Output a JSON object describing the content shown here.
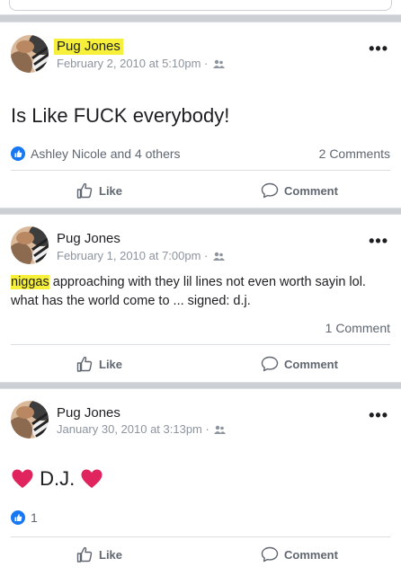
{
  "posts": [
    {
      "author": "Pug Jones",
      "date": "February 2, 2010 at 5:10pm · ",
      "text": "Is Like FUCK everybody!",
      "reactions": "Ashley Nicole and 4 others",
      "comments": "2 Comments"
    },
    {
      "author": "Pug Jones",
      "date": "February 1, 2010 at 7:00pm · ",
      "text_highlight": "niggas",
      "text_rest": " approaching with they lil lines not even worth sayin lol. what has the world come to ... signed: d.j.",
      "comments": "1 Comment"
    },
    {
      "author": "Pug Jones",
      "date": "January 30, 2010 at 3:13pm · ",
      "text": "D.J.",
      "reactions": "1"
    }
  ],
  "actions": {
    "like": "Like",
    "comment": "Comment"
  },
  "colors": {
    "highlight": "#f7f03a",
    "like_blue": "#1877f2",
    "heart": "#e0245e",
    "divider": "#dadde1"
  }
}
